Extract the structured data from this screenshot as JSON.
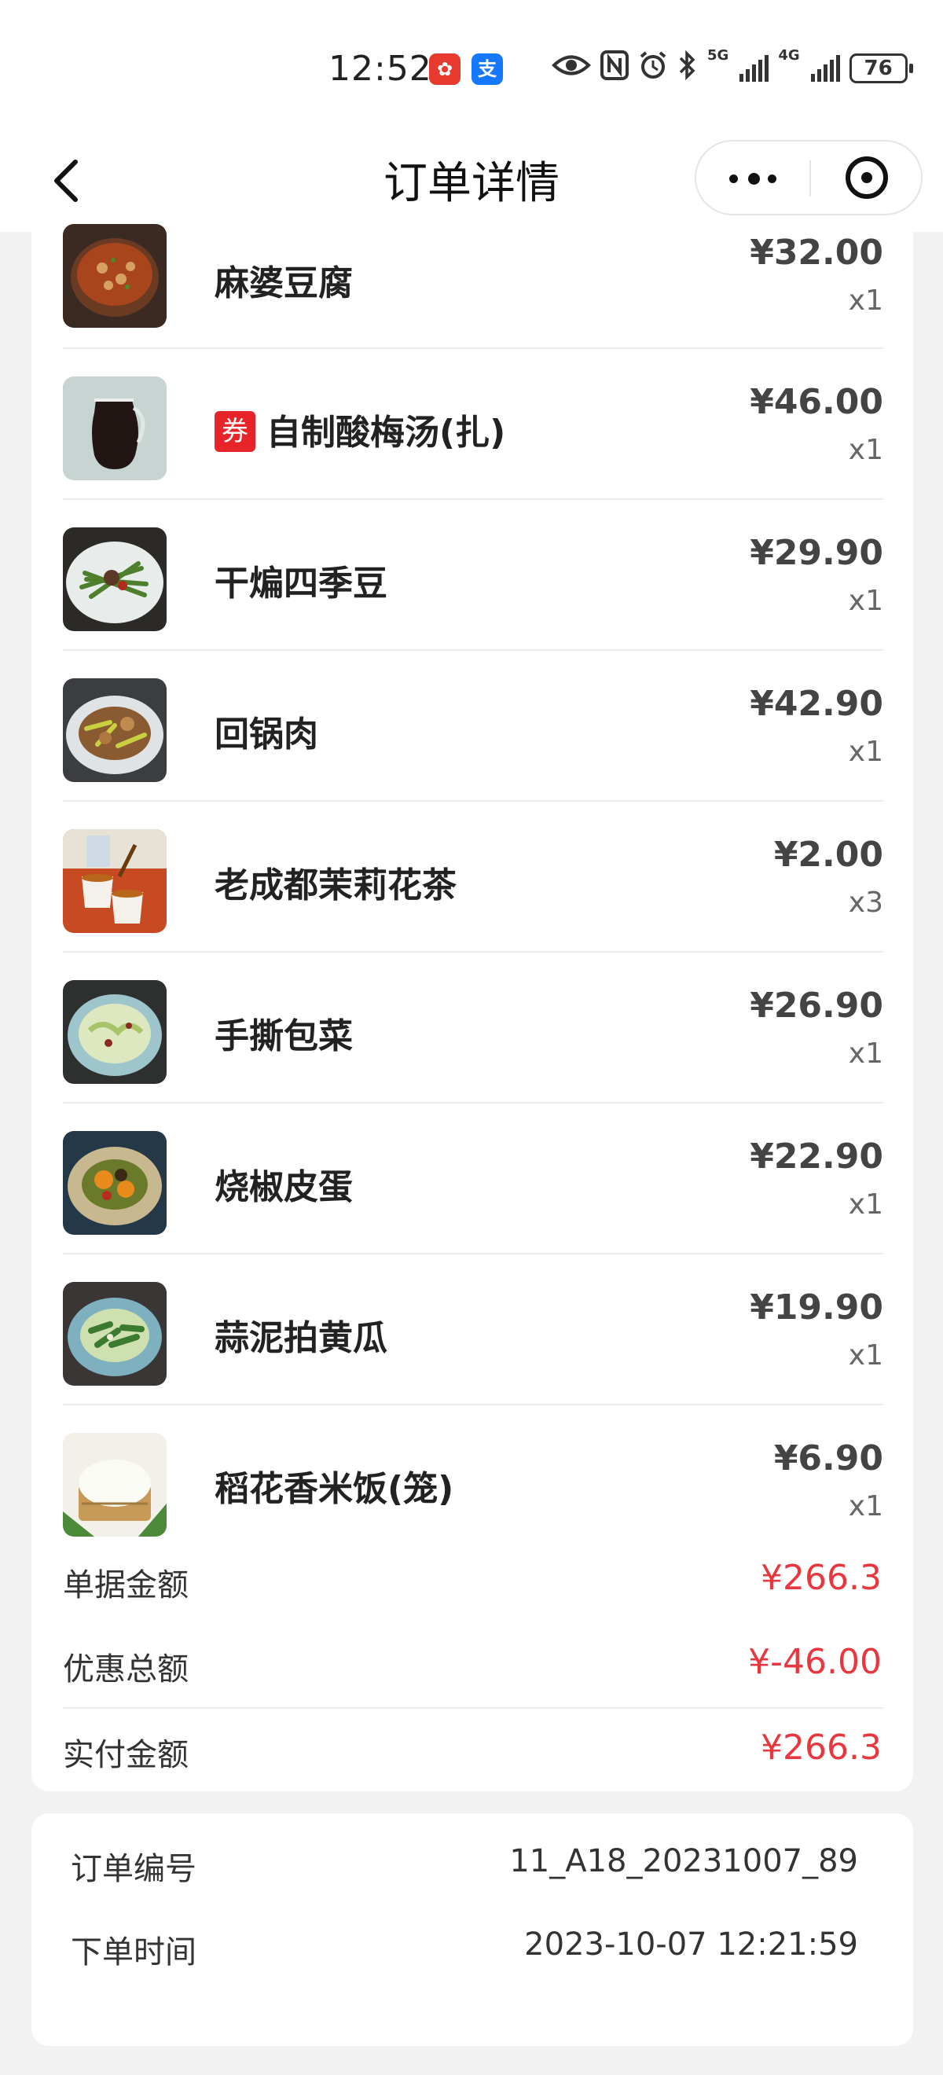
{
  "status_bar": {
    "time": "12:52",
    "app_badge_1": "✿",
    "app_badge_2": "支",
    "network_1": "5G",
    "network_2": "4G",
    "battery": "76"
  },
  "nav": {
    "title": "订单详情"
  },
  "items": [
    {
      "name": "麻婆豆腐",
      "price": "¥32.00",
      "qty": "x1",
      "coupon": false
    },
    {
      "name": "自制酸梅汤(扎)",
      "price": "¥46.00",
      "qty": "x1",
      "coupon": true,
      "coupon_label": "券"
    },
    {
      "name": "干煸四季豆",
      "price": "¥29.90",
      "qty": "x1",
      "coupon": false
    },
    {
      "name": "回锅肉",
      "price": "¥42.90",
      "qty": "x1",
      "coupon": false
    },
    {
      "name": "老成都茉莉花茶",
      "price": "¥2.00",
      "qty": "x3",
      "coupon": false
    },
    {
      "name": "手撕包菜",
      "price": "¥26.90",
      "qty": "x1",
      "coupon": false
    },
    {
      "name": "烧椒皮蛋",
      "price": "¥22.90",
      "qty": "x1",
      "coupon": false
    },
    {
      "name": "蒜泥拍黄瓜",
      "price": "¥19.90",
      "qty": "x1",
      "coupon": false
    },
    {
      "name": "稻花香米饭(笼)",
      "price": "¥6.90",
      "qty": "x1",
      "coupon": false
    }
  ],
  "summary": {
    "bill_label": "单据金额",
    "bill_value": "¥266.3",
    "discount_label": "优惠总额",
    "discount_value": "¥-46.00",
    "paid_label": "实付金额",
    "paid_value": "¥266.3"
  },
  "order_info": {
    "number_label": "订单编号",
    "number_value": "11_A18_20231007_89",
    "time_label": "下单时间",
    "time_value": "2023-10-07 12:21:59"
  },
  "colors": {
    "accent_red": "#e8373f",
    "coupon_red": "#e8242b"
  }
}
